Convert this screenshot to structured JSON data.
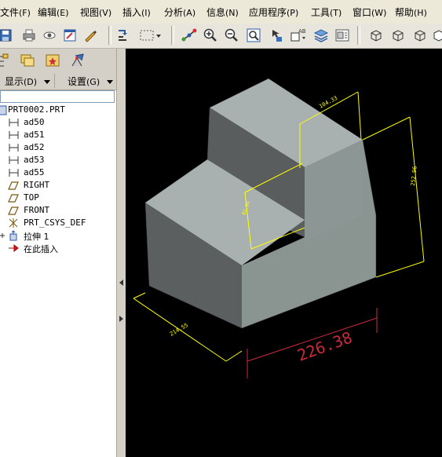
{
  "menu": [
    {
      "label": "文件",
      "accel": "(F)"
    },
    {
      "label": "编辑",
      "accel": "(E)"
    },
    {
      "label": "视图",
      "accel": "(V)"
    },
    {
      "label": "插入",
      "accel": "(I)"
    },
    {
      "label": "分析",
      "accel": "(A)"
    },
    {
      "label": "信息",
      "accel": "(N)"
    },
    {
      "label": "应用程序",
      "accel": "(P)"
    },
    {
      "label": "工具",
      "accel": "(T)"
    },
    {
      "label": "窗口",
      "accel": "(W)"
    },
    {
      "label": "帮助",
      "accel": "(H)"
    }
  ],
  "toolbar_icons": [
    "save-icon",
    "print-icon",
    "view-icon",
    "edit-window-icon",
    "redraw-icon",
    "regenerate-icon",
    "select-box-icon",
    "datum-display-icon",
    "zoom-in-icon",
    "zoom-out-icon",
    "refit-icon",
    "reorient-icon",
    "named-view-icon",
    "layers-icon",
    "view-manager-icon",
    "wireframe-icon",
    "hidden-line-icon",
    "no-hidden-icon"
  ],
  "panel": {
    "show_label": "显示",
    "show_accel": "(D)",
    "settings_label": "设置",
    "settings_accel": "(G)"
  },
  "tree": {
    "root": "PRT0002.PRT",
    "items": [
      {
        "label": "ad50",
        "icon": "dimension-icon"
      },
      {
        "label": "ad51",
        "icon": "dimension-icon"
      },
      {
        "label": "ad52",
        "icon": "dimension-icon"
      },
      {
        "label": "ad53",
        "icon": "dimension-icon"
      },
      {
        "label": "ad55",
        "icon": "dimension-icon"
      },
      {
        "label": "RIGHT",
        "icon": "datum-plane-icon"
      },
      {
        "label": "TOP",
        "icon": "datum-plane-icon"
      },
      {
        "label": "FRONT",
        "icon": "datum-plane-icon"
      },
      {
        "label": "PRT_CSYS_DEF",
        "icon": "csys-icon"
      },
      {
        "label": "拉伸 1",
        "icon": "extrude-icon"
      },
      {
        "label": "在此插入",
        "icon": "insert-here-arrow-icon"
      }
    ]
  },
  "dimensions": {
    "top_width": "104.33",
    "height": "252.96",
    "step_height": "81.96",
    "depth": "214.55",
    "width": "226.38"
  },
  "colors": {
    "dim_yellow": "#ffff00",
    "dim_red": "#cc2a3a",
    "face_top": "#a9b1b0",
    "face_front": "#8a9592",
    "face_left": "#5c5f5f"
  }
}
